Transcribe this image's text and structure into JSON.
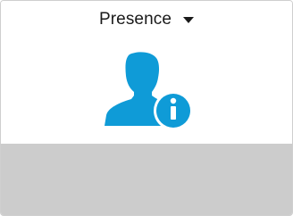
{
  "widget": {
    "dropdown_label": "Presence",
    "icon": "person-info-icon",
    "accent_color": "#0f9bd7",
    "footer_color": "#cccccc"
  }
}
